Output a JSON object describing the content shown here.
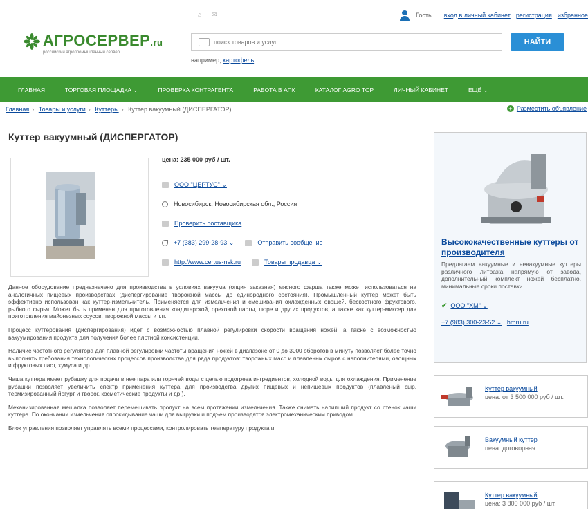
{
  "topbar": {
    "icons": "⌂  ✉",
    "guest": "Гость",
    "login": "вход в личный кабинет",
    "register": "регистрация",
    "favorites": "избранное"
  },
  "logo": {
    "text": "АГРОСЕРВЕР",
    "suffix": ".ru",
    "subtitle": "российский агропромышленный сервер",
    "color": "#3a8a2e"
  },
  "search": {
    "placeholder": "поиск товаров и услуг...",
    "button": "НАЙТИ",
    "example_label": "например,",
    "example_link": "картофель"
  },
  "nav": {
    "color": "#3e9a34",
    "items": [
      "ГЛАВНАЯ",
      "ТОРГОВАЯ ПЛОЩАДКА ⌄",
      "ПРОВЕРКА КОНТРАГЕНТА",
      "РАБОТА В АПК",
      "КАТАЛОГ AGRO TOP",
      "ЛИЧНЫЙ КАБИНЕТ",
      "ЕЩЁ ⌄"
    ]
  },
  "breadcrumb": {
    "items": [
      "Главная",
      "Товары и услуги",
      "Куттеры"
    ],
    "current": "Куттер вакуумный (ДИСПЕРГАТОР)",
    "post_ad": "Разместить объявление"
  },
  "product": {
    "title": "Куттер вакуумный (ДИСПЕРГАТОР)",
    "price": "цена: 235 000 руб / шт.",
    "company": "ООО \"ЦЕРТУС\" ⌄",
    "location": "Новосибирск, Новосибирская обл., Россия",
    "check_supplier": "Проверить поставщика",
    "phone": "+7 (383) 299-28-93 ⌄",
    "send_message": "Отправить сообщение",
    "website": "http://www.certus-nsk.ru",
    "seller_goods": "Товары продавца ⌄"
  },
  "description": [
    "Данное оборудование предназначено для производства в условиях вакуума (опция заказная) мясного фарша также может использоваться на аналогичных пищевых производствах (диспергирование творожной массы до единородного состояния). Промышленный куттер может быть эффективно использован как куттер-измельчитель. Применяется для измельчения и смешивания охлажденных овощей, бескостного фруктового, рыбного сырья. Может быть применен для приготовления кондитерской, ореховой пасты, пюре и других продуктов, а также как куттер-миксер для приготовления майонезных соусов, творожной массы и т.п.",
    "Процесс куттерования (диспергирования) идет с возможностью плавной регулировки скорости вращения ножей, а также с возможностью вакуумирования продукта для получения более плотной консистенции.",
    "Наличие частотного регулятора для плавной регулировки частоты вращения ножей в диапазоне от 0 до 3000 оборотов в минуту позволяет более точно выполнять требования технологических процессов производства для ряда продуктов: творожных масс и плавленых сыров с наполнителями, овощных и фруктовых паст, хумуса и др.",
    "Чаша куттера имеет рубашку для подачи в нее пара или горячей воды с целью подогрева ингредиентов, холодной воды для охлаждения. Применение рубашки позволяет увеличить спектр применения куттера для производства других пищевых и непищевых продуктов (плавленый сыр, термизированный йогурт и творог, косметические продукты и др.).",
    "Механизированная мешалка позволяет перемешивать продукт на всем протяжении измельчения. Также снимать налипший продукт со стенок чаши куттера. По окончании измельчения опрокидывание чаши для выгрузки и подъем производятся электромеханическим приводом.",
    "Блок управления позволяет управлять всеми процессами, контролировать температуру продукта и"
  ],
  "ad": {
    "title": "Высококачественные куттеры от производителя",
    "text": "Предлагаем вакуумные и невакуумные куттеры различного литража напрямую от завода, дополнительный комплект ножей бесплатно, минимальные сроки поставки.",
    "company": "ООО \"ХМ\" ⌄",
    "phone": "+7 (983) 300-23-52 ⌄",
    "site": "hmru.ru"
  },
  "related": [
    {
      "title": "Куттер вакуумный",
      "price": "цена: от 3 500 000 руб / шт."
    },
    {
      "title": "Вакуумный куттер",
      "price": "цена: договорная"
    },
    {
      "title": "Куттер вакуумный",
      "price": "цена: 3 800 000 руб / шт."
    }
  ]
}
